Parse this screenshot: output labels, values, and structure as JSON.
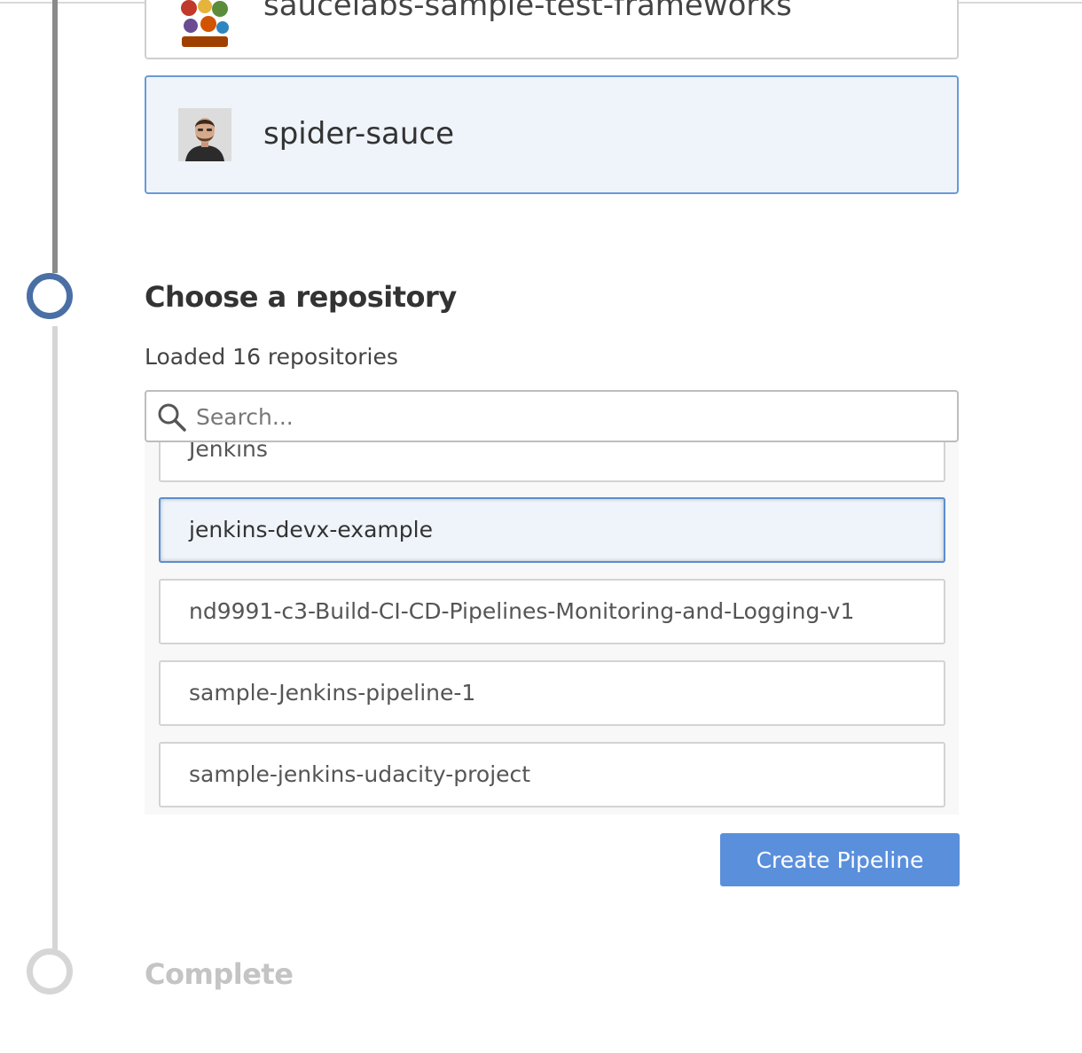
{
  "organizations": {
    "partial_item": {
      "name": "saucelabs-sample-test-frameworks",
      "avatar_icon": "org-avatar-icon"
    },
    "selected_item": {
      "name": "spider-sauce",
      "avatar_icon": "user-avatar-icon"
    }
  },
  "steps": {
    "current": {
      "title": "Choose a repository",
      "status": "active"
    },
    "next": {
      "title": "Complete",
      "status": "pending"
    }
  },
  "repositories": {
    "loaded_text": "Loaded 16 repositories",
    "search": {
      "placeholder": "Search...",
      "value": "",
      "icon": "search-icon"
    },
    "items": [
      {
        "name": "Jenkins",
        "selected": false
      },
      {
        "name": "jenkins-devx-example",
        "selected": true
      },
      {
        "name": "nd9991-c3-Build-CI-CD-Pipelines-Monitoring-and-Logging-v1",
        "selected": false
      },
      {
        "name": "sample-Jenkins-pipeline-1",
        "selected": false
      },
      {
        "name": "sample-jenkins-udacity-project",
        "selected": false
      }
    ]
  },
  "actions": {
    "create_label": "Create Pipeline"
  },
  "colors": {
    "accent": "#5a8fdc",
    "active_step": "#4a6fa5",
    "selected_border": "#6a9ad6",
    "selected_background": "#eff4fb",
    "pending": "#d6d6d6"
  }
}
